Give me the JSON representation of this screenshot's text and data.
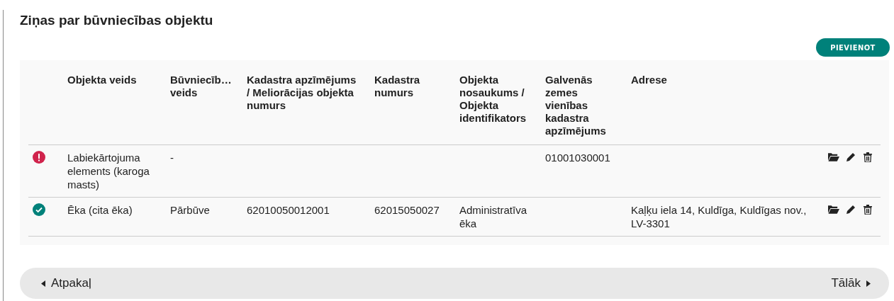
{
  "title": "Ziņas par būvniecības objektu",
  "add_button": "PIEVIENOT",
  "table": {
    "columns": [
      "Objekta veids",
      "Būvniecīb… veids",
      "Kadastra apzīmējums / Meliorācijas objekta numurs",
      "Kadastra numurs",
      "Objekta nosaukums / Objekta identifikators",
      "Galvenās zemes vienības kadastra apzīmējums",
      "Adrese"
    ],
    "rows": [
      {
        "valid": false,
        "cells": [
          "Labiekārtojuma elements (karoga masts)",
          "-",
          "",
          "",
          "",
          "01001030001",
          ""
        ]
      },
      {
        "valid": true,
        "cells": [
          "Ēka (cita ēka)",
          "Pārbūve",
          "62010050012001",
          "62015050027",
          "Administratīva ēka",
          "",
          "Kaļķu iela 14, Kuldīga, Kuldīgas nov., LV-3301"
        ]
      }
    ]
  },
  "nav": {
    "back": "Atpakaļ",
    "next": "Tālāk"
  }
}
